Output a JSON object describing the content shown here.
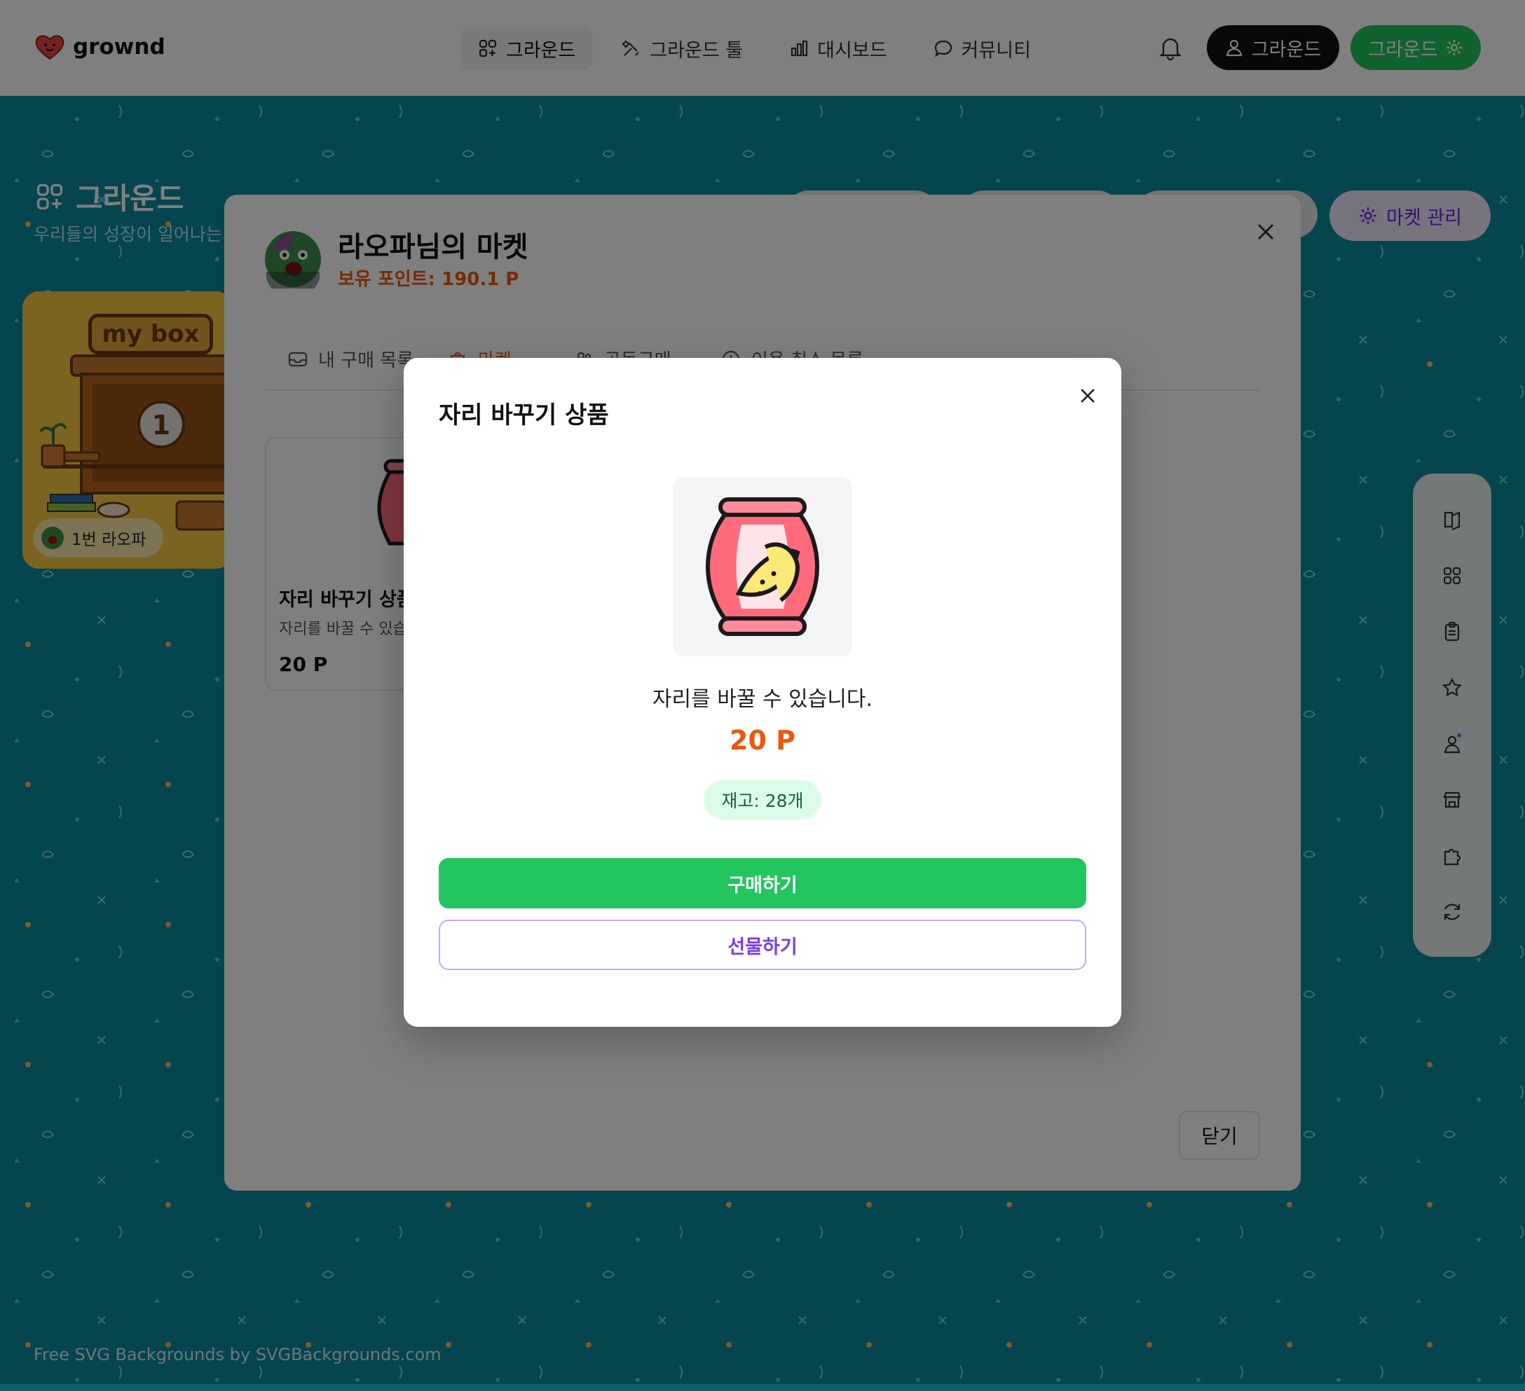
{
  "header": {
    "logo_text": "grownd",
    "nav": [
      {
        "label": "그라운드",
        "icon": "grid-plus-icon",
        "active": true
      },
      {
        "label": "그라운드 툴",
        "icon": "tools-icon",
        "active": false
      },
      {
        "label": "대시보드",
        "icon": "bar-chart-icon",
        "active": false
      },
      {
        "label": "커뮤니티",
        "icon": "chat-bubble-icon",
        "active": false
      }
    ],
    "profile_button": "그라운드",
    "ground_button": "그라운드"
  },
  "page": {
    "title": "그라운드",
    "subtitle": "우리들의 성장이 일어나는",
    "market_manage_button": "마켓 관리",
    "mybox": {
      "tag": "my box",
      "number": "1",
      "owner": "1번 라오파"
    },
    "side_rail_icons": [
      "book-icon",
      "grid-icon",
      "clipboard-icon",
      "star-icon",
      "user-icon",
      "store-icon",
      "puzzle-icon",
      "refresh-icon"
    ],
    "watermark": "Free SVG Backgrounds by SVGBackgrounds.com"
  },
  "market_modal": {
    "title": "라오파님의 마켓",
    "points": "보유 포인트: 190.1 P",
    "tabs": [
      {
        "label": "내 구매 목록",
        "icon": "inbox-icon",
        "active": false
      },
      {
        "label": "마켓",
        "icon": "shopping-bag-icon",
        "active": true
      },
      {
        "label": "공동구매",
        "icon": "users-icon",
        "active": false
      },
      {
        "label": "이용 취소 목록",
        "icon": "clock-icon",
        "active": false
      }
    ],
    "product_card": {
      "name": "자리 바꾸기 상품",
      "description": "자리를 바꿀 수 있습니다.",
      "price": "20 P"
    },
    "close_button": "닫기"
  },
  "detail_modal": {
    "title": "자리 바꾸기 상품",
    "description": "자리를 바꿀 수 있습니다.",
    "price": "20 P",
    "stock": "재고: 28개",
    "buy_button": "구매하기",
    "gift_button": "선물하기"
  },
  "colors": {
    "accent_orange": "#ea580c",
    "primary_green": "#22c55e",
    "gift_purple": "#7c3aed",
    "page_teal": "#0b8a9c"
  }
}
